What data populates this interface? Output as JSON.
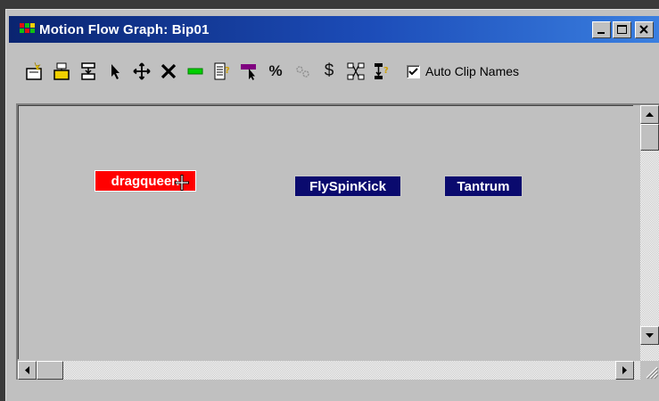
{
  "window": {
    "title": "Motion Flow Graph: Bip01"
  },
  "toolbar": {
    "tools": [
      "create-clip-icon",
      "create-multiple-clips-icon",
      "create-transition-icon",
      "select-clips-icon",
      "move-clips-icon",
      "delete-clips-icon",
      "create-random-motions-icon",
      "show-clip-properties-icon",
      "select-random-start-clip-icon",
      "percent-transitions-icon",
      "optimize-transitions-icon",
      "cost-icon",
      "create-unique-motions-icon",
      "set-shared-motion-flow-icon"
    ],
    "percent_label": "%",
    "dollar_label": "$",
    "auto_clip_names_label": "Auto Clip Names",
    "auto_clip_names_checked": true
  },
  "clips": [
    {
      "label": "dragqueen",
      "state": "selected"
    },
    {
      "label": "FlySpinKick",
      "state": "normal"
    },
    {
      "label": "Tantrum",
      "state": "normal"
    }
  ],
  "colors": {
    "title_gradient_start": "#0a2470",
    "title_gradient_end": "#3a7fe0",
    "selected_clip": "#ff0000",
    "clip": "#0a0a6e",
    "background": "#c0c0c0"
  }
}
